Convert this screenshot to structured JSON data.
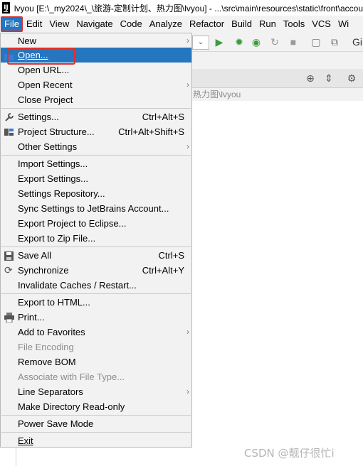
{
  "window": {
    "title": "lvyou [E:\\_my2024\\_\\旅游-定制计划、热力图\\lvyou] - ...\\src\\main\\resources\\static\\front\\accou",
    "app_icon_text": "IJ"
  },
  "menubar": [
    "File",
    "Edit",
    "View",
    "Navigate",
    "Code",
    "Analyze",
    "Refactor",
    "Build",
    "Run",
    "Tools",
    "VCS",
    "Wi"
  ],
  "toolbar": {
    "combo_label": "⌄",
    "git_label": "Gi"
  },
  "panel": {
    "path": "热力图\\lvyou"
  },
  "file_menu": {
    "new": "New",
    "open": "Open...",
    "open_url": "Open URL...",
    "open_recent": "Open Recent",
    "close_project": "Close Project",
    "settings": "Settings...",
    "settings_sc": "Ctrl+Alt+S",
    "project_structure": "Project Structure...",
    "project_structure_sc": "Ctrl+Alt+Shift+S",
    "other_settings": "Other Settings",
    "import_settings": "Import Settings...",
    "export_settings": "Export Settings...",
    "settings_repository": "Settings Repository...",
    "sync_settings": "Sync Settings to JetBrains Account...",
    "export_eclipse": "Export Project to Eclipse...",
    "export_zip": "Export to Zip File...",
    "save_all": "Save All",
    "save_all_sc": "Ctrl+S",
    "synchronize": "Synchronize",
    "synchronize_sc": "Ctrl+Alt+Y",
    "invalidate": "Invalidate Caches / Restart...",
    "export_html": "Export to HTML...",
    "print": "Print...",
    "add_favorites": "Add to Favorites",
    "file_encoding": "File Encoding",
    "remove_bom": "Remove BOM",
    "associate": "Associate with File Type...",
    "line_separators": "Line Separators",
    "make_readonly": "Make Directory Read-only",
    "power_save": "Power Save Mode",
    "exit": "Exit"
  },
  "watermark": "CSDN @靓仔很忙i",
  "colors": {
    "selection": "#2675bf",
    "highlight_border": "#e0302a",
    "run_green": "#3c9c3c"
  }
}
